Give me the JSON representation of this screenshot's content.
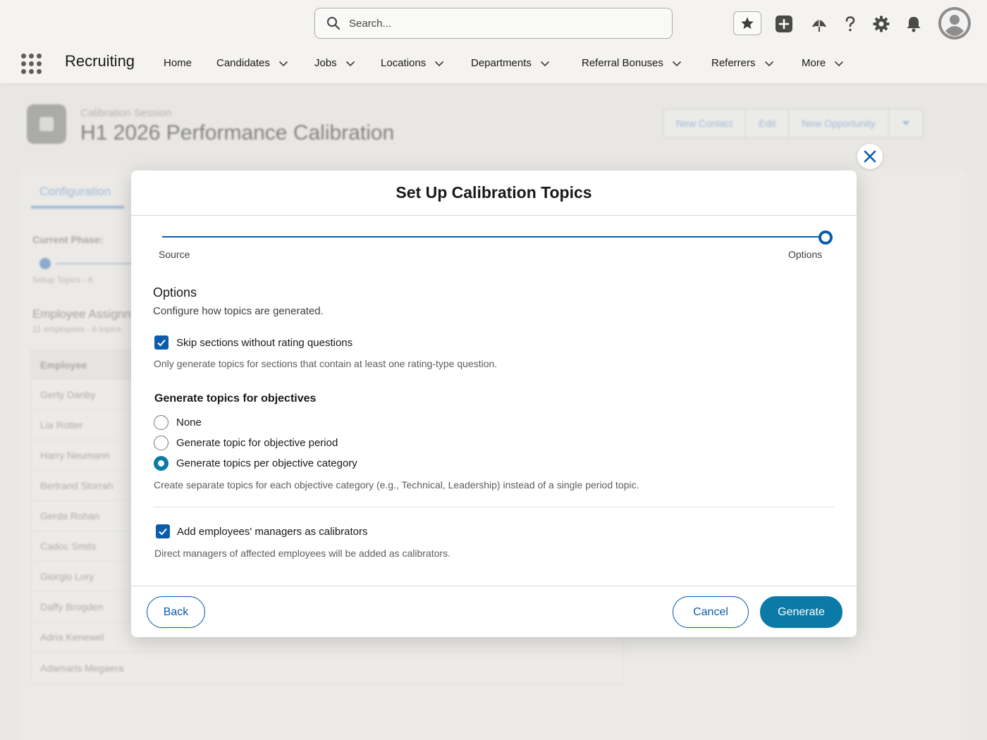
{
  "header": {
    "search_placeholder": "Search..."
  },
  "nav": {
    "app_name": "Recruiting",
    "items": [
      {
        "label": "Home"
      },
      {
        "label": "Candidates"
      },
      {
        "label": "Jobs"
      },
      {
        "label": "Locations"
      },
      {
        "label": "Departments"
      },
      {
        "label": "Referral Bonuses"
      },
      {
        "label": "Referrers"
      },
      {
        "label": "More"
      }
    ]
  },
  "record": {
    "type": "Calibration Session",
    "title": "H1 2026 Performance Calibration",
    "actions": [
      "New Contact",
      "Edit",
      "New Opportunity"
    ],
    "tab": "Configuration",
    "phase_label": "Current Phase:",
    "phase_step": "Setup Topics - 6",
    "assign_title": "Employee Assignments",
    "assign_sub": "11 employees - 6 topics",
    "table_header": "Employee",
    "employees": [
      "Gerty Danby",
      "Lia Rotter",
      "Harry Neumann",
      "Bertrand Storrah",
      "Gerda Rohan",
      "Cadoc Smits",
      "Giorgio Lory",
      "Daffy Brogden",
      "Adria Kenewel",
      "Adamaris Megaera"
    ]
  },
  "modal": {
    "title": "Set Up Calibration Topics",
    "steps": [
      "Source",
      "Options"
    ],
    "section_title": "Options",
    "section_sub": "Configure how topics are generated.",
    "skip_label": "Skip sections without rating questions",
    "skip_help": "Only generate topics for sections that contain at least one rating-type question.",
    "skip_checked": true,
    "objectives_title": "Generate topics for objectives",
    "objective_options": [
      "None",
      "Generate topic for objective period",
      "Generate topics per objective category"
    ],
    "objective_selected": "Generate topics per objective category",
    "objectives_help": "Create separate topics for each objective category (e.g., Technical, Leadership) instead of a single period topic.",
    "managers_label": "Add employees' managers as calibrators",
    "managers_help": "Direct managers of affected employees will be added as calibrators.",
    "managers_checked": true,
    "back_label": "Back",
    "cancel_label": "Cancel",
    "generate_label": "Generate"
  },
  "colors": {
    "brand": "#0b5cab",
    "primary_button": "#0b7aa6"
  }
}
